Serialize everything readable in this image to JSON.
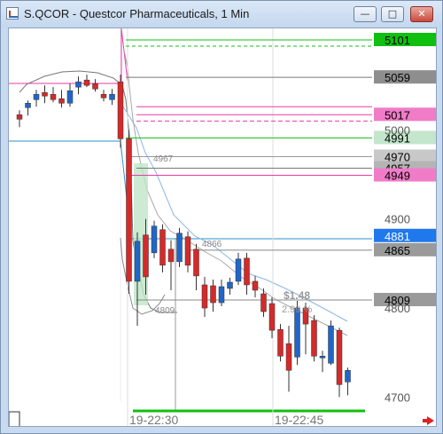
{
  "window": {
    "title": "S.QCOR - Questcor Pharmaceuticals, 1 Min",
    "buttons": [
      "—",
      "□",
      "✕"
    ]
  },
  "colors": {
    "up": "#2166c9",
    "down": "#d42a2a",
    "green_tag": "#10c010",
    "gray_tag": "#9a9a9a",
    "pink_tag": "#f08ad0",
    "light_green_tag": "#c6ead0",
    "blue_tag": "#2a7ee8"
  },
  "price_tags": [
    {
      "label": "5101",
      "price": 5101,
      "bg": "#10c010",
      "fg": "#000"
    },
    {
      "label": "5059",
      "price": 5059,
      "bg": "#8e8e8e",
      "fg": "#000"
    },
    {
      "label": "5017",
      "price": 5017,
      "bg": "#f07cc8",
      "fg": "#000"
    },
    {
      "label": "4991",
      "price": 4991,
      "bg": "#c3e6cc",
      "fg": "#000"
    },
    {
      "label": "4970",
      "price": 4970,
      "bg": "#c8c8c8",
      "fg": "#000"
    },
    {
      "label": "4957",
      "price": 4957,
      "bg": "#b4b4b4",
      "fg": "#000"
    },
    {
      "label": "4949",
      "price": 4949,
      "bg": "#f07cc8",
      "fg": "#000"
    },
    {
      "label": "4881",
      "price": 4881,
      "bg": "#1f78ec",
      "fg": "#fff"
    },
    {
      "label": "4865",
      "price": 4865,
      "bg": "#9a9a9a",
      "fg": "#000"
    },
    {
      "label": "4809",
      "price": 4809,
      "bg": "#9a9a9a",
      "fg": "#000"
    }
  ],
  "axis_labels": [
    {
      "label": "5000",
      "price": 5000
    },
    {
      "label": "4900",
      "price": 4900
    },
    {
      "label": "4800",
      "price": 4800
    },
    {
      "label": "4700",
      "price": 4700
    }
  ],
  "chart_labels": {
    "level_4967": "4967",
    "level_4866": "4866",
    "level_4809": "4809",
    "pnl": "$1.48",
    "pnl_pct": "2.99 %"
  },
  "time_labels": [
    "19-22:30",
    "19-22:45"
  ],
  "chart_data": {
    "type": "candlestick",
    "candles": [
      {
        "o": 5017,
        "h": 5022,
        "l": 5003,
        "c": 5012
      },
      {
        "o": 5025,
        "h": 5033,
        "l": 5016,
        "c": 5030
      },
      {
        "o": 5034,
        "h": 5045,
        "l": 5026,
        "c": 5040
      },
      {
        "o": 5042,
        "h": 5050,
        "l": 5030,
        "c": 5038
      },
      {
        "o": 5040,
        "h": 5048,
        "l": 5031,
        "c": 5034
      },
      {
        "o": 5035,
        "h": 5045,
        "l": 5025,
        "c": 5030
      },
      {
        "o": 5030,
        "h": 5052,
        "l": 5026,
        "c": 5044
      },
      {
        "o": 5048,
        "h": 5060,
        "l": 5040,
        "c": 5054
      },
      {
        "o": 5056,
        "h": 5062,
        "l": 5048,
        "c": 5050
      },
      {
        "o": 5052,
        "h": 5057,
        "l": 5043,
        "c": 5046
      },
      {
        "o": 5040,
        "h": 5045,
        "l": 5032,
        "c": 5036
      },
      {
        "o": 5034,
        "h": 5046,
        "l": 5028,
        "c": 5040
      },
      {
        "o": 5054,
        "h": 5062,
        "l": 4980,
        "c": 4990
      },
      {
        "o": 4990,
        "h": 5000,
        "l": 4816,
        "c": 4830
      },
      {
        "o": 4830,
        "h": 4885,
        "l": 4780,
        "c": 4875
      },
      {
        "o": 4882,
        "h": 4900,
        "l": 4815,
        "c": 4835
      },
      {
        "o": 4862,
        "h": 4898,
        "l": 4856,
        "c": 4892
      },
      {
        "o": 4888,
        "h": 4894,
        "l": 4840,
        "c": 4848
      },
      {
        "o": 4866,
        "h": 4876,
        "l": 4820,
        "c": 4852
      },
      {
        "o": 4852,
        "h": 4890,
        "l": 4846,
        "c": 4884
      },
      {
        "o": 4880,
        "h": 4886,
        "l": 4840,
        "c": 4848
      },
      {
        "o": 4866,
        "h": 4872,
        "l": 4820,
        "c": 4836
      },
      {
        "o": 4826,
        "h": 4835,
        "l": 4790,
        "c": 4800
      },
      {
        "o": 4825,
        "h": 4832,
        "l": 4796,
        "c": 4806
      },
      {
        "o": 4806,
        "h": 4832,
        "l": 4802,
        "c": 4824
      },
      {
        "o": 4822,
        "h": 4834,
        "l": 4815,
        "c": 4829
      },
      {
        "o": 4830,
        "h": 4862,
        "l": 4826,
        "c": 4855
      },
      {
        "o": 4856,
        "h": 4862,
        "l": 4815,
        "c": 4826
      },
      {
        "o": 4830,
        "h": 4836,
        "l": 4812,
        "c": 4820
      },
      {
        "o": 4816,
        "h": 4822,
        "l": 4790,
        "c": 4796
      },
      {
        "o": 4805,
        "h": 4812,
        "l": 4766,
        "c": 4775
      },
      {
        "o": 4776,
        "h": 4782,
        "l": 4740,
        "c": 4746
      },
      {
        "o": 4760,
        "h": 4780,
        "l": 4706,
        "c": 4730
      },
      {
        "o": 4745,
        "h": 4808,
        "l": 4736,
        "c": 4800
      },
      {
        "o": 4800,
        "h": 4806,
        "l": 4748,
        "c": 4782
      },
      {
        "o": 4786,
        "h": 4792,
        "l": 4740,
        "c": 4746
      },
      {
        "o": 4744,
        "h": 4752,
        "l": 4728,
        "c": 4746
      },
      {
        "o": 4738,
        "h": 4786,
        "l": 4736,
        "c": 4780
      },
      {
        "o": 4775,
        "h": 4778,
        "l": 4700,
        "c": 4714
      },
      {
        "o": 4717,
        "h": 4733,
        "l": 4702,
        "c": 4730
      }
    ]
  }
}
